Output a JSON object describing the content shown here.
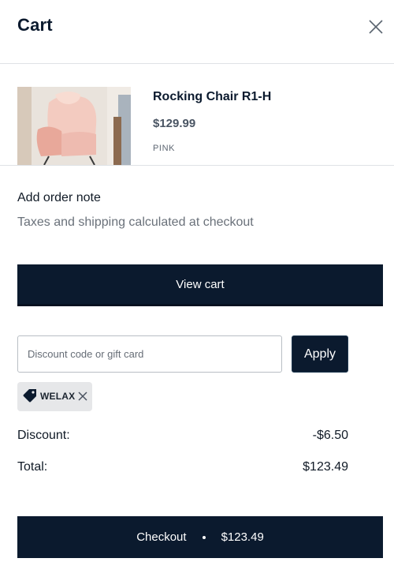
{
  "header": {
    "title": "Cart",
    "close_icon": "close-icon"
  },
  "item": {
    "name": "Rocking Chair R1-H",
    "price": "$129.99",
    "variant": "PINK"
  },
  "notes": {
    "order_note": "Add order note",
    "tax_note": "Taxes and shipping calculated at checkout"
  },
  "buttons": {
    "view_cart": "View cart",
    "apply": "Apply",
    "checkout": "Checkout",
    "checkout_total": "$123.49"
  },
  "discount": {
    "placeholder": "Discount code or gift card",
    "value": "",
    "applied_code": "WELAX",
    "label": "Discount:",
    "amount": "-$6.50"
  },
  "totals": {
    "label": "Total:",
    "amount": "$123.49"
  },
  "colors": {
    "primary": "#0b1a2e",
    "chip_bg": "#e6e7e9"
  }
}
